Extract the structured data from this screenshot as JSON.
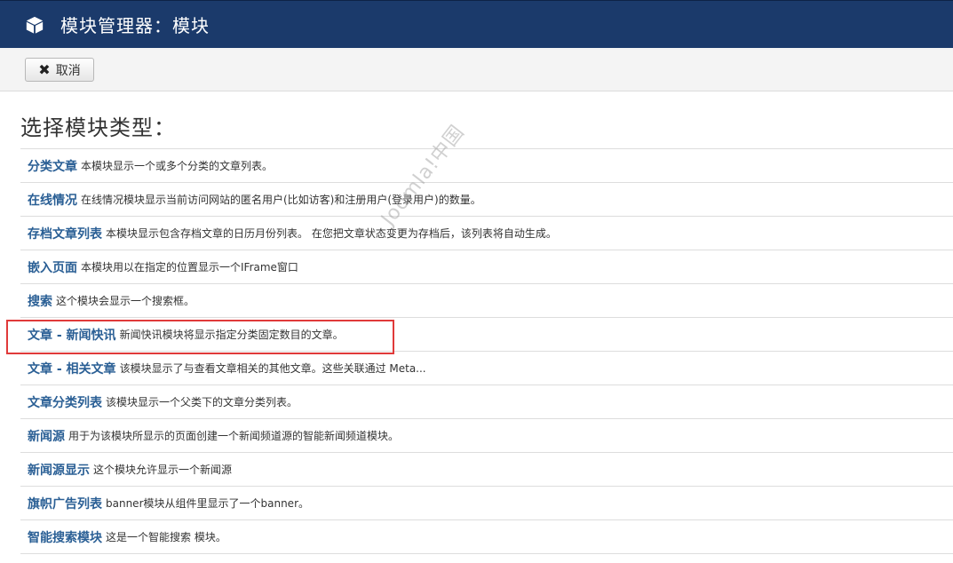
{
  "header": {
    "title": "模块管理器：模块"
  },
  "toolbar": {
    "cancel_label": "取消"
  },
  "heading": "选择模块类型：",
  "modules": [
    {
      "name": "分类文章",
      "desc": "本模块显示一个或多个分类的文章列表。"
    },
    {
      "name": "在线情况",
      "desc": "在线情况模块显示当前访问网站的匿名用户(比如访客)和注册用户(登录用户)的数量。"
    },
    {
      "name": "存档文章列表",
      "desc": "本模块显示包含存档文章的日历月份列表。 在您把文章状态变更为存档后，该列表将自动生成。"
    },
    {
      "name": "嵌入页面",
      "desc": "本模块用以在指定的位置显示一个IFrame窗口"
    },
    {
      "name": "搜索",
      "desc": "这个模块会显示一个搜索框。"
    },
    {
      "name": "文章 - 新闻快讯",
      "desc": "新闻快讯模块将显示指定分类固定数目的文章。"
    },
    {
      "name": "文章 - 相关文章",
      "desc": "该模块显示了与查看文章相关的其他文章。这些关联通过 Meta..."
    },
    {
      "name": "文章分类列表",
      "desc": "该模块显示一个父类下的文章分类列表。"
    },
    {
      "name": "新闻源",
      "desc": "用于为该模块所显示的页面创建一个新闻频道源的智能新闻频道模块。"
    },
    {
      "name": "新闻源显示",
      "desc": "这个模块允许显示一个新闻源"
    },
    {
      "name": "旗帜广告列表",
      "desc": "banner模块从组件里显示了一个banner。"
    },
    {
      "name": "智能搜索模块",
      "desc": "这是一个智能搜索 模块。"
    }
  ],
  "watermark": "Joomla!中国",
  "colors": {
    "header_bg": "#1b3a6b",
    "link": "#2a5f95",
    "highlight": "#e03a3a"
  },
  "icons": {
    "header": "cube-icon",
    "cancel": "close-icon"
  }
}
